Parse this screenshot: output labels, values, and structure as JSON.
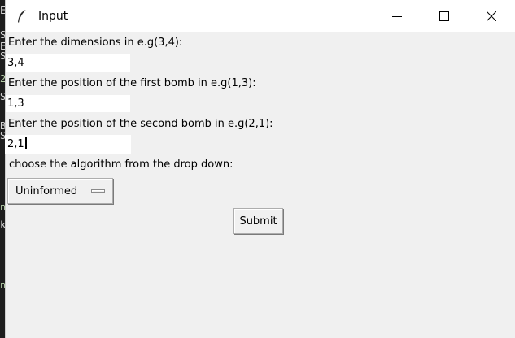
{
  "window": {
    "title": "Input"
  },
  "form": {
    "dimensions_label": "Enter the dimensions in e.g(3,4):",
    "dimensions_value": "3,4",
    "bomb1_label": "Enter the position of the first bomb in e.g(1,3):",
    "bomb1_value": "1,3",
    "bomb2_label": "Enter the position of the second bomb in e.g(2,1):",
    "bomb2_value": "2,1",
    "algorithm_label": "choose the algorithm from the drop down:",
    "algorithm_selected": "Uninformed",
    "submit_label": "Submit"
  },
  "colors": {
    "window_bg": "#f0f0f0",
    "titlebar_bg": "#ffffff",
    "field_bg": "#ffffff"
  },
  "icons": {
    "app": "feather-icon",
    "minimize": "minimize-icon",
    "maximize": "maximize-icon",
    "close": "close-icon"
  }
}
